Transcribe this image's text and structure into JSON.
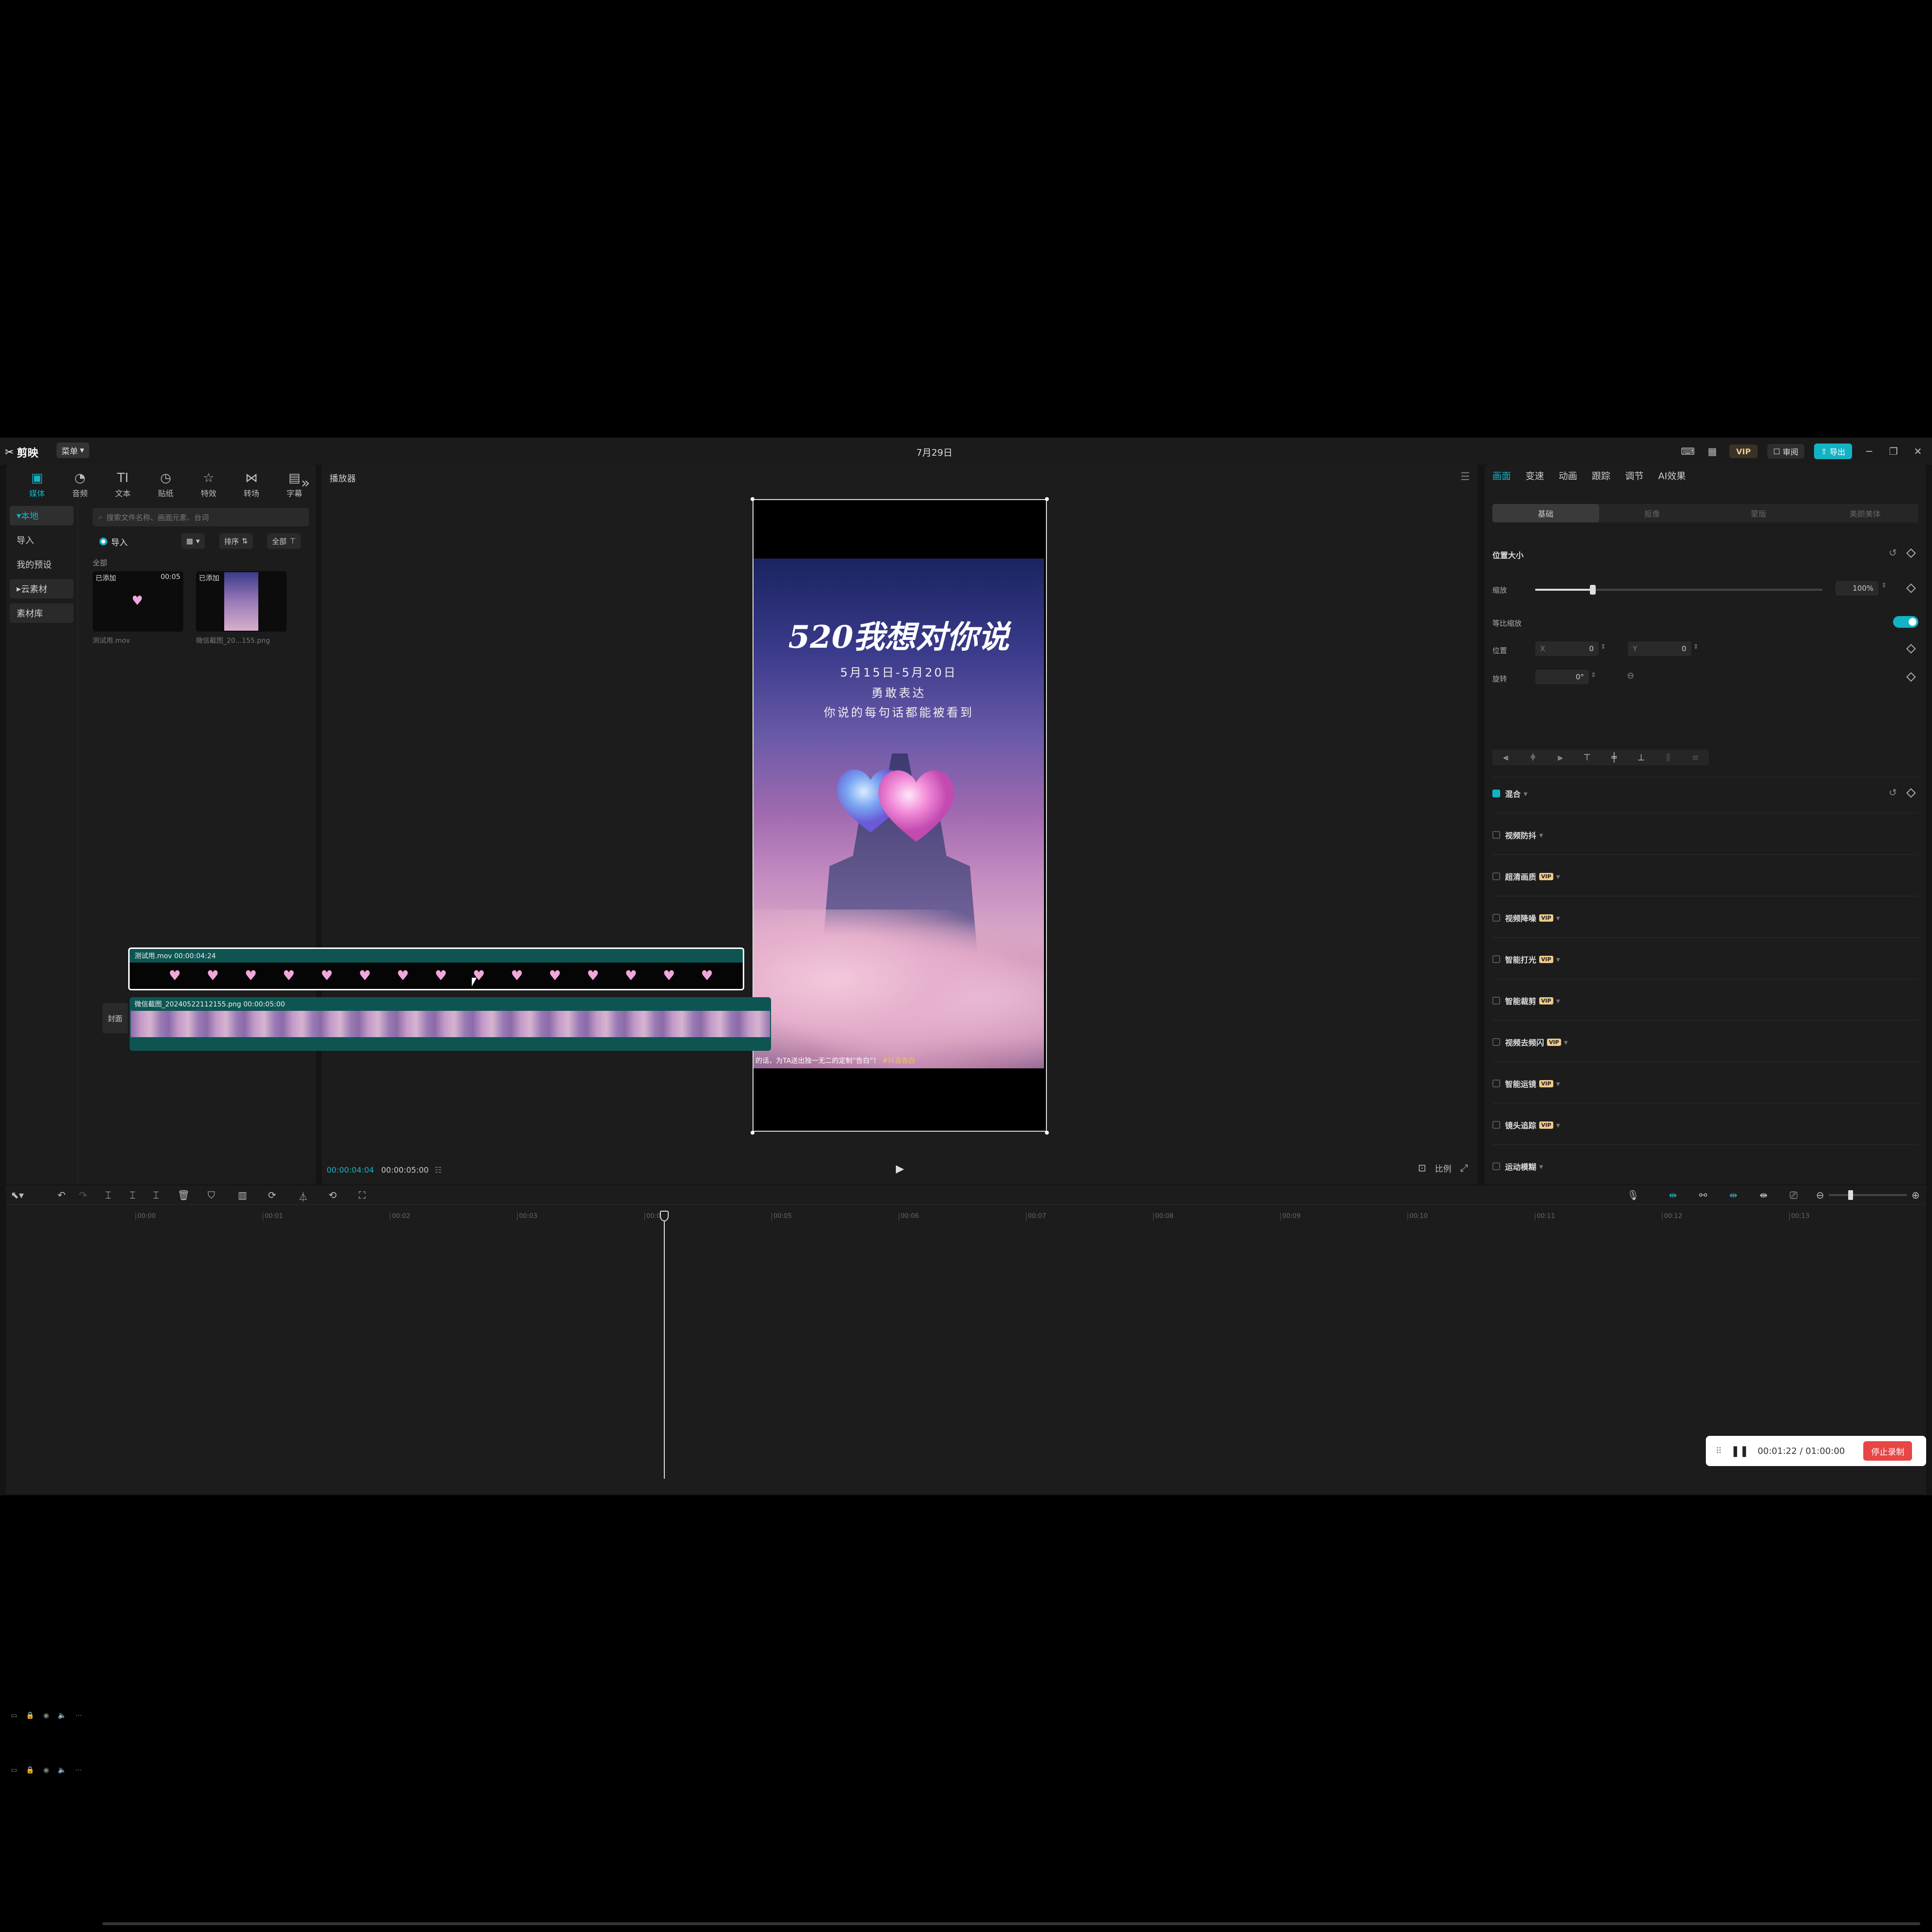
{
  "titlebar": {
    "app_name": "剪映",
    "menu_label": "菜单",
    "title": "7月29日",
    "vip_label": "VIP",
    "review_label": "审阅",
    "export_label": "导出"
  },
  "left_panel": {
    "tools": [
      {
        "label": "媒体",
        "icon": "media-icon"
      },
      {
        "label": "音频",
        "icon": "audio-icon"
      },
      {
        "label": "文本",
        "icon": "text-icon"
      },
      {
        "label": "贴纸",
        "icon": "sticker-icon"
      },
      {
        "label": "特效",
        "icon": "effects-icon"
      },
      {
        "label": "转场",
        "icon": "transition-icon"
      },
      {
        "label": "字幕",
        "icon": "caption-icon"
      }
    ],
    "nav": [
      "本地",
      "导入",
      "我的预设",
      "云素材",
      "素材库"
    ],
    "search_placeholder": "搜索文件名称、画面元素、台词",
    "import_label": "导入",
    "sort_label": "排序",
    "filter_label": "全部",
    "all_label": "全部",
    "media_items": [
      {
        "tag": "已添加",
        "duration": "00:05",
        "name": "测试用.mov"
      },
      {
        "tag": "已添加",
        "duration": "",
        "name": "微信截图_20...155.png"
      }
    ]
  },
  "player": {
    "title": "播放器",
    "current_time": "00:00:04:04",
    "total_time": "00:00:05:00",
    "ratio_label": "比例",
    "preview": {
      "headline": "520我想对你说",
      "date_line": "5月15日-5月20日",
      "line2": "勇敢表达",
      "line3": "你说的每句话都能被看到",
      "footer": "的话，为TA送出独一无二的定制“告白”！",
      "footer_tag": "#抖音告白"
    }
  },
  "properties": {
    "tabs": [
      "画面",
      "变速",
      "动画",
      "跟踪",
      "调节",
      "AI效果"
    ],
    "subtabs": [
      "基础",
      "抠像",
      "蒙版",
      "美颜美体"
    ],
    "position_size_label": "位置大小",
    "scale_label": "缩放",
    "scale_value": "100%",
    "scale_fraction": 0.2,
    "uniform_label": "等比缩放",
    "position_label": "位置",
    "x_value": "0",
    "y_value": "0",
    "rotation_label": "旋转",
    "rotation_value": "0°",
    "options": [
      {
        "label": "混合",
        "checked": true,
        "vip": false
      },
      {
        "label": "视频防抖",
        "checked": false,
        "vip": false
      },
      {
        "label": "超清画质",
        "checked": false,
        "vip": true
      },
      {
        "label": "视频降噪",
        "checked": false,
        "vip": true
      },
      {
        "label": "智能打光",
        "checked": false,
        "vip": true
      },
      {
        "label": "智能裁剪",
        "checked": false,
        "vip": true
      },
      {
        "label": "视频去频闪",
        "checked": false,
        "vip": true
      },
      {
        "label": "智能运镜",
        "checked": false,
        "vip": true
      },
      {
        "label": "镜头追踪",
        "checked": false,
        "vip": true
      },
      {
        "label": "运动模糊",
        "checked": false,
        "vip": false
      }
    ],
    "vip_tag": "VIP"
  },
  "timeline": {
    "ruler": [
      "00:00",
      "00:01",
      "00:02",
      "00:03",
      "00:04",
      "00:05",
      "00:06",
      "00:07",
      "00:08",
      "00:09",
      "00:10",
      "00:11",
      "00:12",
      "00:13"
    ],
    "clip1_label": "测试用.mov  00:00:04:24",
    "clip2_label": "微信截图_20240522112155.png  00:00:05:00",
    "cover_label": "封面"
  },
  "recording": {
    "time": "00:01:22 / 01:00:00",
    "stop_label": "停止录制"
  }
}
